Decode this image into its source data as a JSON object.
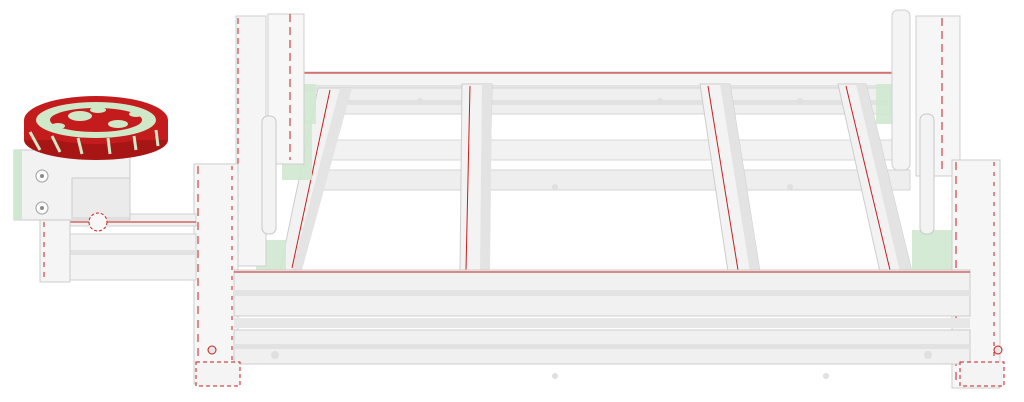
{
  "scene": {
    "description_visible_text": "",
    "colors": {
      "background": "#ffffff",
      "profile_fill": "#f3f3f3",
      "profile_face": "#e9e9e9",
      "profile_shadow": "#d8d8d8",
      "edge_red": "#c81e1e",
      "bracket_green": "#cfe8cf",
      "knob_red": "#c41c1c",
      "knob_green": "#cfe8c8",
      "outline": "#bdbdbd"
    },
    "icons": [
      "aluminum-extrusion-frame",
      "rotary-knob",
      "motor-mount"
    ]
  }
}
